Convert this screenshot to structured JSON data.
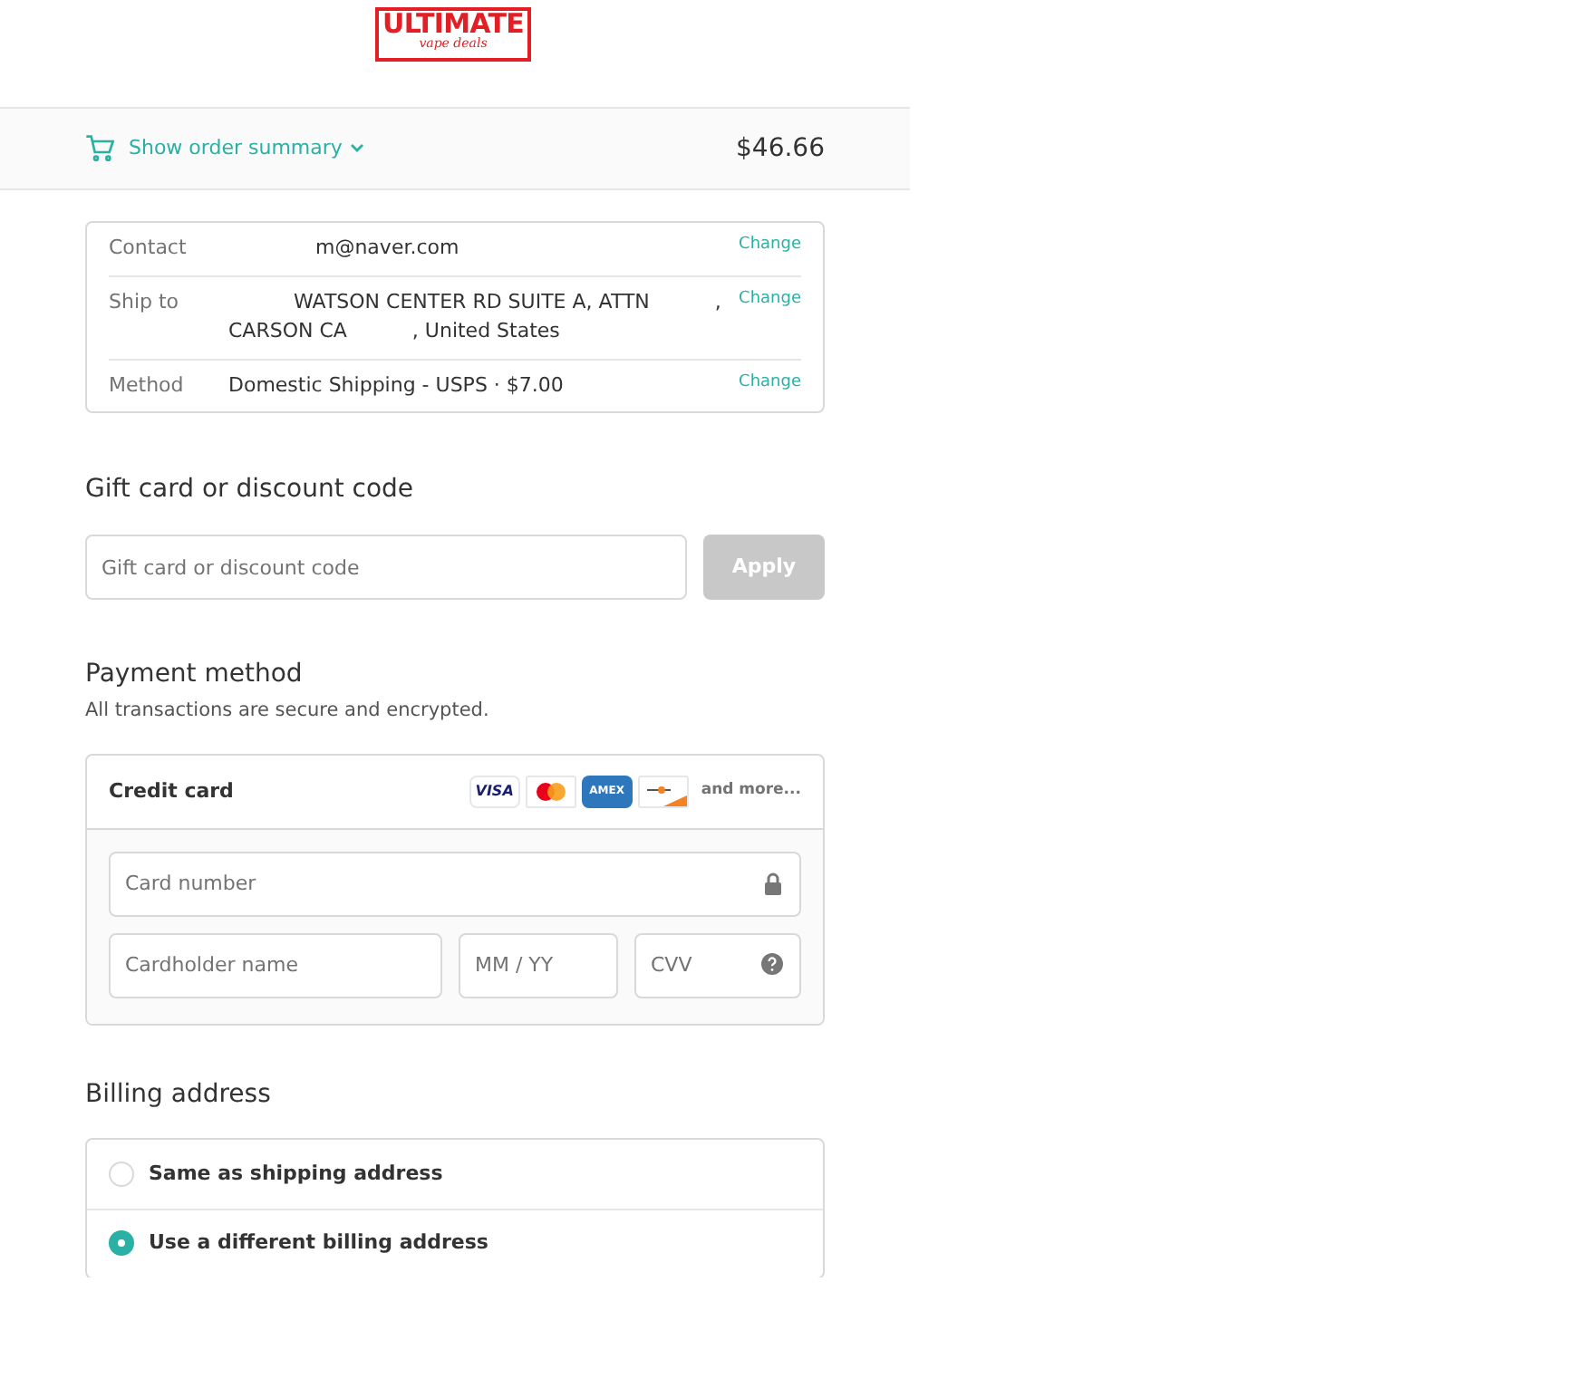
{
  "logo": {
    "title": "ULTIMATE",
    "subtitle": "vape deals"
  },
  "order_summary": {
    "label": "Show order summary",
    "expanded": false,
    "total": "$46.66"
  },
  "review": [
    {
      "label": "Contact",
      "lines": [
        [
          "m@naver.com"
        ]
      ],
      "action": "Change"
    },
    {
      "label": "Ship to",
      "lines": [
        [
          "WATSON CENTER RD SUITE A, ATTN",
          ","
        ],
        [
          "CARSON CA",
          ", United States"
        ]
      ],
      "action": "Change"
    },
    {
      "label": "Method",
      "lines": [
        [
          "Domestic Shipping - USPS · $7.00"
        ]
      ],
      "action": "Change"
    }
  ],
  "discount": {
    "heading": "Gift card or discount code",
    "placeholder": "Gift card or discount code",
    "button": "Apply",
    "disabled": true
  },
  "payment": {
    "heading": "Payment method",
    "subtitle": "All transactions are secure and encrypted.",
    "method": "Credit card",
    "cards": [
      {
        "kind": "visa",
        "label": "VISA"
      },
      {
        "kind": "mastercard"
      },
      {
        "kind": "amex",
        "label": "AMEX"
      },
      {
        "kind": "discover"
      }
    ],
    "more": "and more...",
    "fields": {
      "card_number": {
        "placeholder": "Card number"
      },
      "name": {
        "placeholder": "Cardholder name"
      },
      "expiry": {
        "placeholder": "MM / YY"
      },
      "cvv": {
        "placeholder": "CVV"
      }
    }
  },
  "billing": {
    "heading": "Billing address",
    "options": [
      {
        "label": "Same as shipping address",
        "selected": false
      },
      {
        "label": "Use a different billing address",
        "selected": true
      }
    ]
  }
}
